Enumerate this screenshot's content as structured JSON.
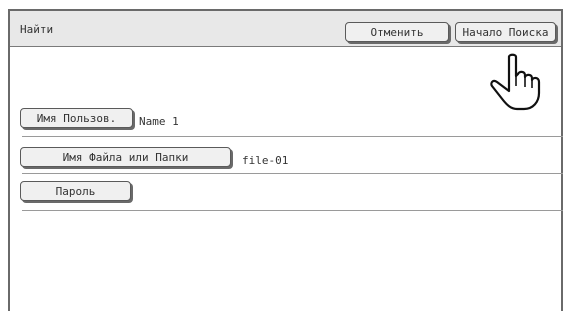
{
  "header": {
    "title": "Найти",
    "cancel_label": "Отменить",
    "start_label": "Начало Поиска"
  },
  "fields": {
    "user": {
      "label": "Имя Пользов.",
      "value": "Name 1"
    },
    "file": {
      "label": "Имя Файла или Папки",
      "value": "file-01"
    },
    "password": {
      "label": "Пароль"
    }
  },
  "icons": {
    "pointer": "pointing-hand-icon"
  }
}
